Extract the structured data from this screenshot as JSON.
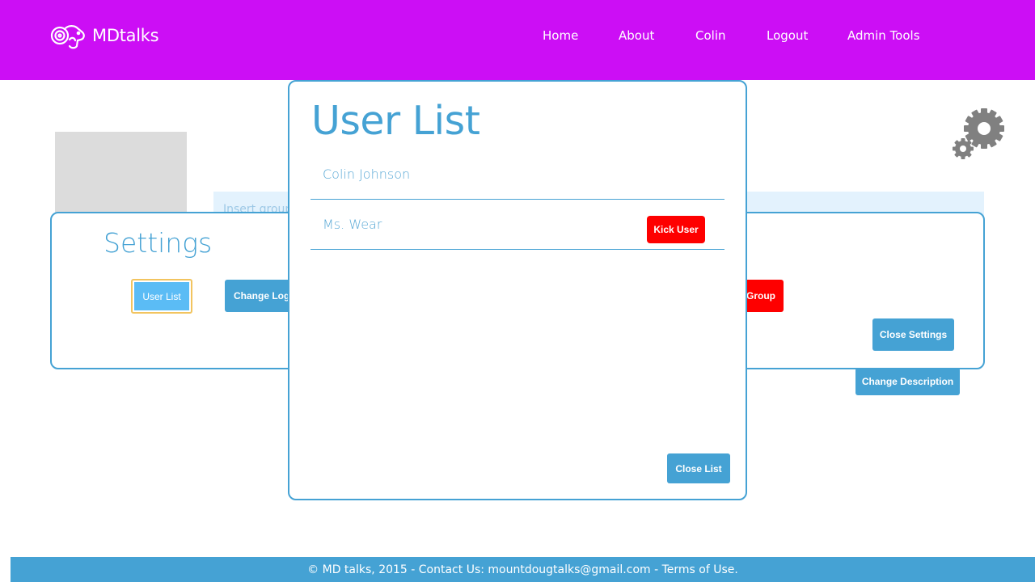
{
  "header": {
    "logo_text": "MDtalks",
    "nav": [
      "Home",
      "About",
      "Colin",
      "Logout",
      "Admin Tools"
    ]
  },
  "group": {
    "description_placeholder": "Insert group description"
  },
  "settings": {
    "title": "Settings",
    "user_list_label": "User List",
    "change_logo_label": "Change Logo",
    "delete_group_label": "Delete Group",
    "close_settings_label": "Close Settings"
  },
  "change_description_label": "Change Description",
  "user_list": {
    "title": "User List",
    "users": [
      {
        "name": "Colin Johnson"
      },
      {
        "name": "Ms. Wear",
        "action": "Kick User"
      }
    ],
    "close_label": "Close List"
  },
  "footer": {
    "text": "© MD talks, 2015 - Contact Us: mountdougtalks@gmail.com - Terms of Use."
  },
  "colors": {
    "header": "#cc0ef5",
    "accent": "#45a2d4",
    "danger": "#fe0000"
  },
  "icons": [
    "ram-logo-icon",
    "gear-icon"
  ]
}
